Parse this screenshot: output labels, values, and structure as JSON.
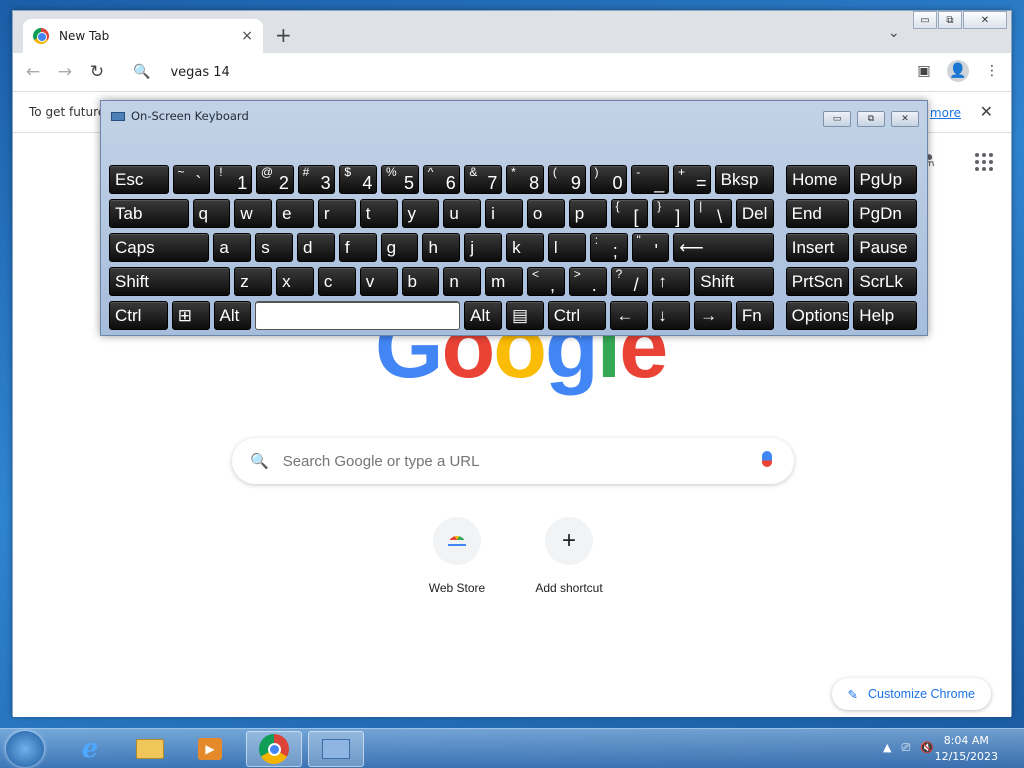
{
  "browser": {
    "tab_title": "New Tab",
    "tab_close": "×",
    "new_tab": "+",
    "tab_search": "⌄",
    "window_buttons": {
      "minimize": "▭",
      "restore": "⧉",
      "close": "✕"
    },
    "nav": {
      "back": "←",
      "forward": "→",
      "reload": "↻"
    },
    "omnibox_value": "vegas 14",
    "infobar": {
      "text": "To get future",
      "link": "more",
      "close": "✕"
    }
  },
  "page": {
    "logo": "Google",
    "search_placeholder": "Search Google or type a URL",
    "shortcuts": [
      {
        "label": "Web Store"
      },
      {
        "label": "Add shortcut"
      }
    ],
    "customize_label": "Customize Chrome"
  },
  "osk": {
    "title": "On-Screen Keyboard",
    "rows": [
      [
        {
          "t": "Esc",
          "w": 60
        },
        {
          "s": "~",
          "m": "`",
          "w": 38
        },
        {
          "s": "!",
          "m": "1",
          "w": 38
        },
        {
          "s": "@",
          "m": "2",
          "w": 38
        },
        {
          "s": "#",
          "m": "3",
          "w": 38
        },
        {
          "s": "$",
          "m": "4",
          "w": 38
        },
        {
          "s": "%",
          "m": "5",
          "w": 38
        },
        {
          "s": "^",
          "m": "6",
          "w": 38
        },
        {
          "s": "&",
          "m": "7",
          "w": 38
        },
        {
          "s": "*",
          "m": "8",
          "w": 38
        },
        {
          "s": "(",
          "m": "9",
          "w": 38
        },
        {
          "s": ")",
          "m": "0",
          "w": 38
        },
        {
          "s": "-",
          "m": "_",
          "w": 38
        },
        {
          "s": "+",
          "m": "=",
          "w": 38
        },
        {
          "t": "Bksp",
          "w": 60
        },
        {
          "gap": 1
        },
        {
          "t": "Home",
          "w": 64
        },
        {
          "t": "PgUp",
          "w": 64
        }
      ],
      [
        {
          "t": "Tab",
          "w": 80
        },
        {
          "t": "q",
          "w": 38
        },
        {
          "t": "w",
          "w": 38
        },
        {
          "t": "e",
          "w": 38
        },
        {
          "t": "r",
          "w": 38
        },
        {
          "t": "t",
          "w": 38
        },
        {
          "t": "y",
          "w": 38
        },
        {
          "t": "u",
          "w": 38
        },
        {
          "t": "i",
          "w": 38
        },
        {
          "t": "o",
          "w": 38
        },
        {
          "t": "p",
          "w": 38
        },
        {
          "s": "{",
          "m": "[",
          "w": 38
        },
        {
          "s": "}",
          "m": "]",
          "w": 38
        },
        {
          "s": "|",
          "m": "\\",
          "w": 38
        },
        {
          "t": "Del",
          "w": 38
        },
        {
          "gap": 1
        },
        {
          "t": "End",
          "w": 64
        },
        {
          "t": "PgDn",
          "w": 64
        }
      ],
      [
        {
          "t": "Caps",
          "w": 101
        },
        {
          "t": "a",
          "w": 38
        },
        {
          "t": "s",
          "w": 38
        },
        {
          "t": "d",
          "w": 38
        },
        {
          "t": "f",
          "w": 38
        },
        {
          "t": "g",
          "w": 38
        },
        {
          "t": "h",
          "w": 38
        },
        {
          "t": "j",
          "w": 38
        },
        {
          "t": "k",
          "w": 38
        },
        {
          "t": "l",
          "w": 38
        },
        {
          "s": ":",
          "m": ";",
          "w": 38
        },
        {
          "s": "\"",
          "m": "'",
          "w": 38
        },
        {
          "t": "⟵",
          "w": 101
        },
        {
          "gap": 1
        },
        {
          "t": "Insert",
          "w": 64
        },
        {
          "t": "Pause",
          "w": 64
        }
      ],
      [
        {
          "t": "Shift",
          "w": 122
        },
        {
          "t": "z",
          "w": 38
        },
        {
          "t": "x",
          "w": 38
        },
        {
          "t": "c",
          "w": 38
        },
        {
          "t": "v",
          "w": 38
        },
        {
          "t": "b",
          "w": 38
        },
        {
          "t": "n",
          "w": 38
        },
        {
          "t": "m",
          "w": 38
        },
        {
          "s": "<",
          "m": ",",
          "w": 38
        },
        {
          "s": ">",
          "m": ".",
          "w": 38
        },
        {
          "s": "?",
          "m": "/",
          "w": 38
        },
        {
          "t": "↑",
          "w": 38
        },
        {
          "t": "Shift",
          "w": 80
        },
        {
          "gap": 1
        },
        {
          "t": "PrtScn",
          "w": 64
        },
        {
          "t": "ScrLk",
          "w": 64
        }
      ],
      [
        {
          "t": "Ctrl",
          "w": 59
        },
        {
          "t": "⊞",
          "w": 38
        },
        {
          "t": "Alt",
          "w": 38
        },
        {
          "t": "",
          "w": 206,
          "space": 1
        },
        {
          "t": "Alt",
          "w": 38
        },
        {
          "t": "▤",
          "w": 38
        },
        {
          "t": "Ctrl",
          "w": 59
        },
        {
          "t": "←",
          "w": 38
        },
        {
          "t": "↓",
          "w": 38
        },
        {
          "t": "→",
          "w": 38
        },
        {
          "t": "Fn",
          "w": 38
        },
        {
          "gap": 1
        },
        {
          "t": "Options",
          "w": 64
        },
        {
          "t": "Help",
          "w": 64
        }
      ]
    ]
  },
  "taskbar": {
    "time": "8:04 AM",
    "date": "12/15/2023",
    "tray": [
      "▲",
      "⎚",
      "🔇"
    ]
  }
}
